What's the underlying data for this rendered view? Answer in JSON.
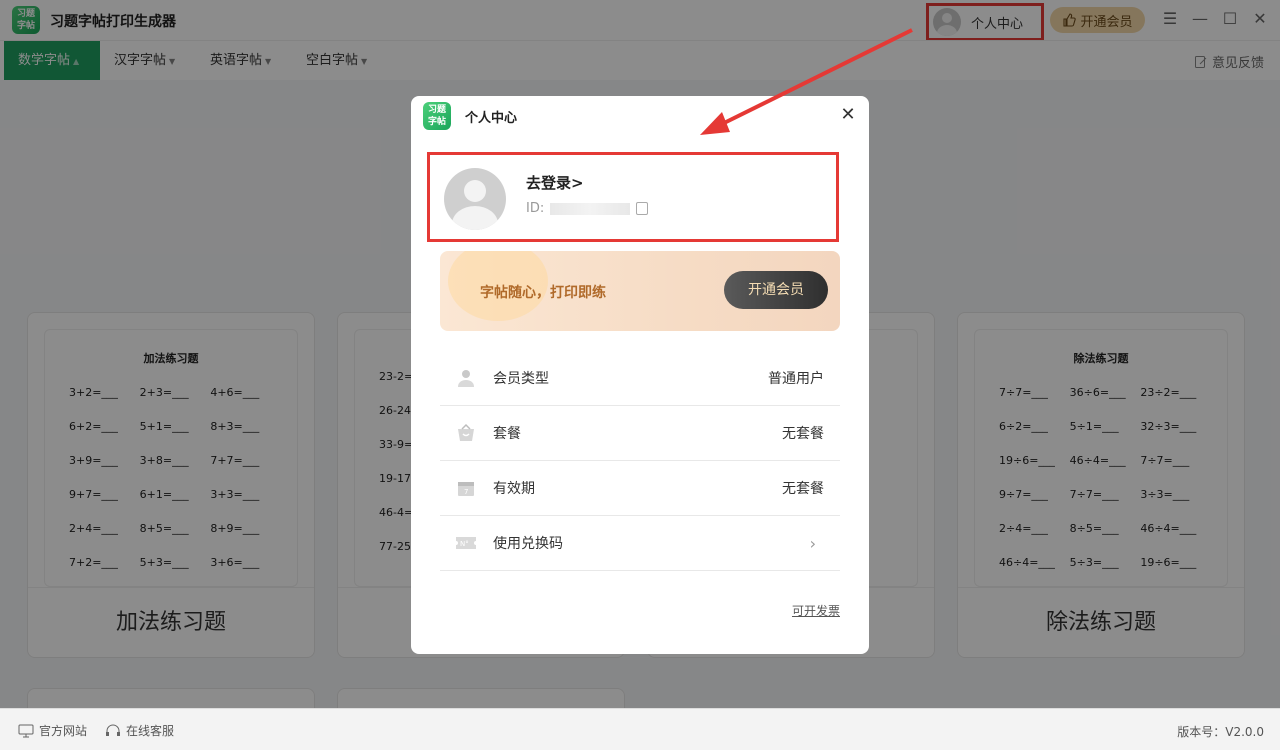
{
  "app": {
    "logo_text": [
      "习题",
      "字帖"
    ],
    "title": "习题字帖打印生成器"
  },
  "titlebar": {
    "user_center": "个人中心",
    "vip_button": "开通会员",
    "menu_icon": "menu-icon",
    "minimize_icon": "minimize-icon",
    "maximize_icon": "maximize-icon",
    "close_icon": "close-icon"
  },
  "nav": {
    "items": [
      {
        "label": "数学字帖",
        "active": true
      },
      {
        "label": "汉字字帖",
        "active": false
      },
      {
        "label": "英语字帖",
        "active": false
      },
      {
        "label": "空白字帖",
        "active": false
      }
    ],
    "feedback": "意见反馈"
  },
  "cards": [
    {
      "label": "加法练习题",
      "sheet_title": "加法练习题",
      "problems": [
        "3+2=___",
        "2+3=___",
        "4+6=___",
        "6+2=___",
        "5+1=___",
        "8+3=___",
        "3+9=___",
        "3+8=___",
        "7+7=___",
        "9+7=___",
        "6+1=___",
        "3+3=___",
        "2+4=___",
        "8+5=___",
        "8+9=___",
        "7+2=___",
        "5+3=___",
        "3+6=___"
      ]
    },
    {
      "label": "",
      "sheet_title": "",
      "problems": [
        "23-2=",
        "",
        "",
        "26-24",
        "",
        "",
        "33-9=",
        "",
        "",
        "19-17",
        "",
        "",
        "46-4=",
        "",
        "",
        "77-25",
        "",
        ""
      ]
    },
    {
      "label": "",
      "sheet_title": "",
      "problems": []
    },
    {
      "label": "除法练习题",
      "sheet_title": "除法练习题",
      "problems": [
        "7÷7=___",
        "36÷6=___",
        "23÷2=___",
        "6÷2=___",
        "5÷1=___",
        "32÷3=___",
        "19÷6=___",
        "46÷4=___",
        "7÷7=___",
        "9÷7=___",
        "7÷7=___",
        "3÷3=___",
        "2÷4=___",
        "8÷5=___",
        "46÷4=___",
        "46÷4=___",
        "5÷3=___",
        "19÷6=___"
      ]
    }
  ],
  "footer": {
    "website": "官方网站",
    "support": "在线客服",
    "version": "版本号：V2.0.0"
  },
  "modal": {
    "title": "个人中心",
    "login": "去登录>",
    "id_label": "ID:",
    "banner_slogan": "字帖随心，打印即练",
    "banner_button": "开通会员",
    "rows": [
      {
        "label": "会员类型",
        "value": "普通用户",
        "icon": "user-icon"
      },
      {
        "label": "套餐",
        "value": "无套餐",
        "icon": "bag-icon"
      },
      {
        "label": "有效期",
        "value": "无套餐",
        "icon": "calendar-icon"
      },
      {
        "label": "使用兑换码",
        "value": "",
        "icon": "coupon-icon"
      }
    ],
    "invoice": "可开发票"
  },
  "colors": {
    "accent": "#1f9f61",
    "highlight": "#e53935",
    "vip_gold": "#b06a2a"
  }
}
